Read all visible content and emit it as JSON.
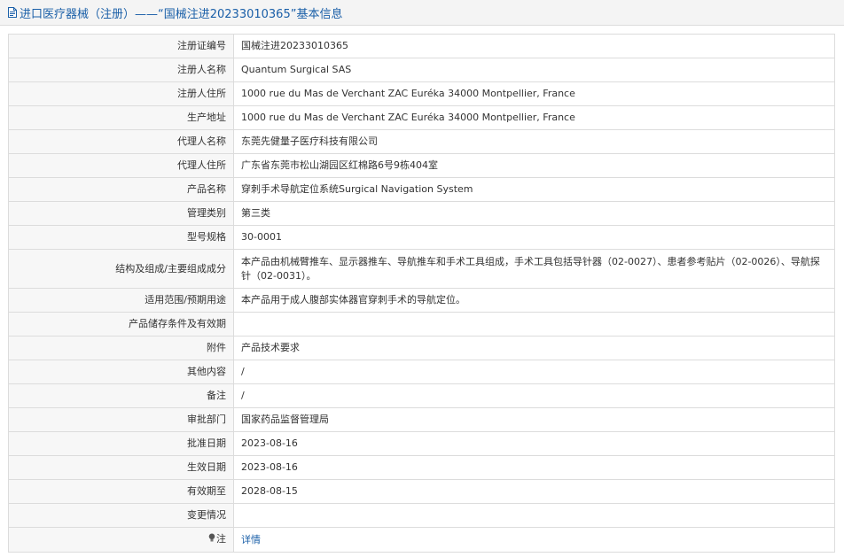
{
  "header": {
    "title": "进口医疗器械（注册）——“国械注进20233010365”基本信息",
    "icon": "document-icon"
  },
  "rows": [
    {
      "label": "注册证编号",
      "value": "国械注进20233010365"
    },
    {
      "label": "注册人名称",
      "value": "Quantum Surgical SAS"
    },
    {
      "label": "注册人住所",
      "value": "1000 rue du Mas de Verchant ZAC Euréka 34000 Montpellier, France"
    },
    {
      "label": "生产地址",
      "value": "1000 rue du Mas de Verchant ZAC Euréka 34000 Montpellier, France"
    },
    {
      "label": "代理人名称",
      "value": "东莞先健量子医疗科技有限公司"
    },
    {
      "label": "代理人住所",
      "value": "广东省东莞市松山湖园区红棉路6号9栋404室"
    },
    {
      "label": "产品名称",
      "value": "穿刺手术导航定位系统Surgical Navigation System"
    },
    {
      "label": "管理类别",
      "value": "第三类"
    },
    {
      "label": "型号规格",
      "value": "30-0001"
    },
    {
      "label": "结构及组成/主要组成成分",
      "value": "本产品由机械臂推车、显示器推车、导航推车和手术工具组成，手术工具包括导针器（02-0027）、患者参考贴片（02-0026）、导航探针（02-0031）。"
    },
    {
      "label": "适用范围/预期用途",
      "value": "本产品用于成人腹部实体器官穿刺手术的导航定位。"
    },
    {
      "label": "产品储存条件及有效期",
      "value": ""
    },
    {
      "label": "附件",
      "value": "产品技术要求"
    },
    {
      "label": "其他内容",
      "value": "/"
    },
    {
      "label": "备注",
      "value": "/"
    },
    {
      "label": "审批部门",
      "value": "国家药品监督管理局"
    },
    {
      "label": "批准日期",
      "value": "2023-08-16"
    },
    {
      "label": "生效日期",
      "value": "2023-08-16"
    },
    {
      "label": "有效期至",
      "value": "2028-08-15"
    },
    {
      "label": "变更情况",
      "value": ""
    }
  ],
  "note_row": {
    "icon": "lightbulb-icon",
    "label": "注",
    "link_text": "详情"
  },
  "colors": {
    "link": "#1a5fa8",
    "label_bg": "#f7f7f7",
    "border": "#dcdcdc"
  }
}
